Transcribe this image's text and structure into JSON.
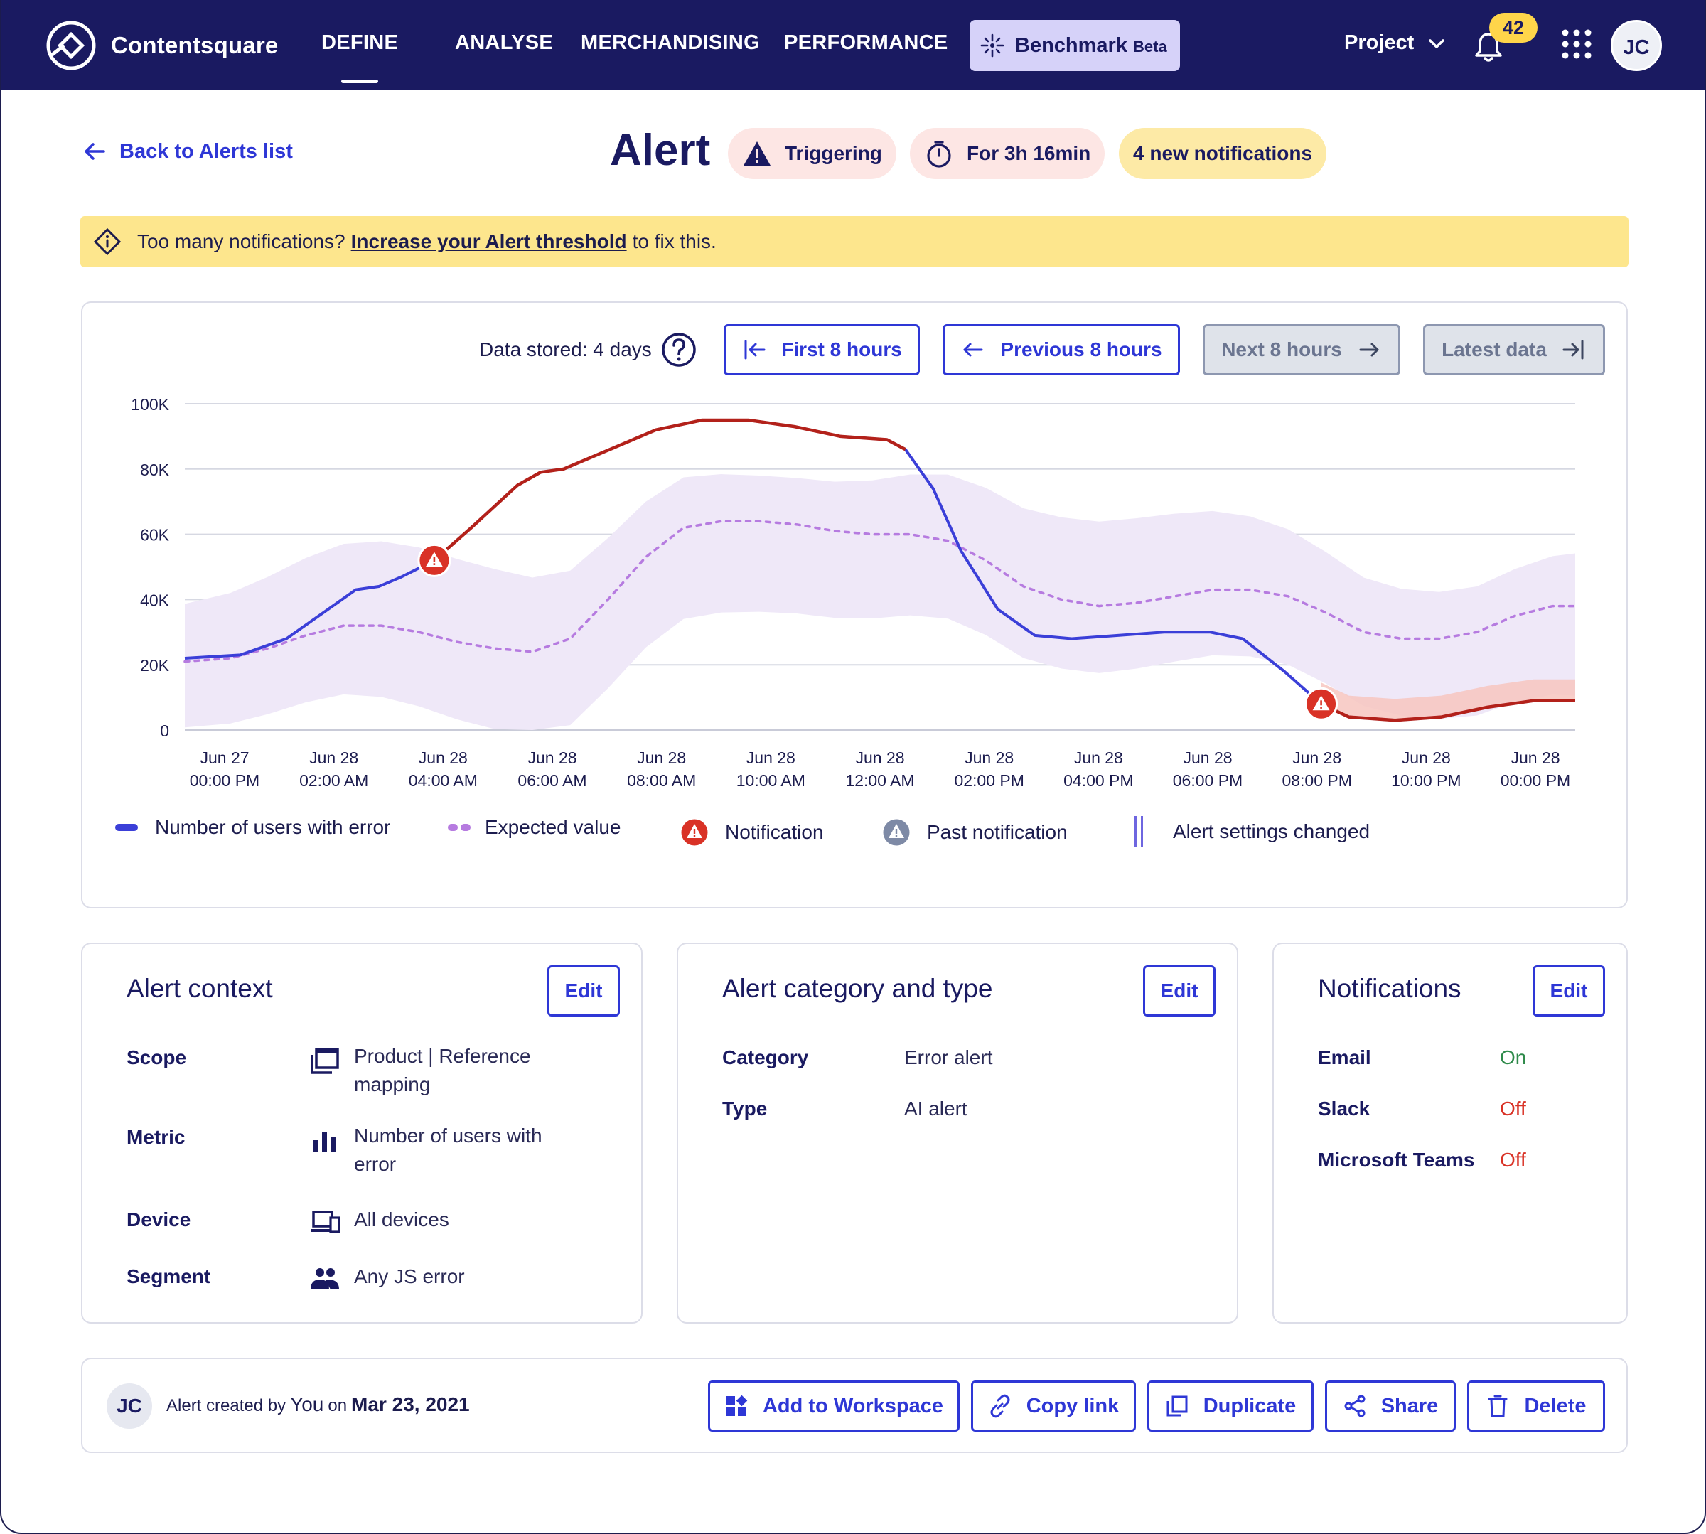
{
  "nav": {
    "brand": "Contentsquare",
    "links": [
      "DEFINE",
      "ANALYSE",
      "MERCHANDISING",
      "PERFORMANCE"
    ],
    "benchmark_label": "Benchmark",
    "benchmark_badge": "Beta",
    "project_label": "Project",
    "notification_count": "42",
    "user_initials": "JC"
  },
  "header": {
    "back_label": "Back to Alerts list",
    "title": "Alert",
    "status_pill": "Triggering",
    "duration_pill": "For 3h 16min",
    "notifications_pill": "4 new notifications"
  },
  "banner": {
    "prefix": "Too many notifications?",
    "link": "Increase your Alert threshold",
    "suffix": "to fix this."
  },
  "chart_controls": {
    "data_stored": "Data stored: 4 days",
    "first_label": "First 8 hours",
    "previous_label": "Previous 8 hours",
    "next_label": "Next 8 hours",
    "latest_label": "Latest data"
  },
  "chart_data": {
    "type": "line",
    "y_ticks": [
      "100K",
      "80K",
      "60K",
      "40K",
      "20K",
      "0"
    ],
    "ylim": [
      0,
      100000
    ],
    "x_ticks": [
      [
        "Jun 27",
        "00:00 PM"
      ],
      [
        "Jun 28",
        "02:00 AM"
      ],
      [
        "Jun 28",
        "04:00 AM"
      ],
      [
        "Jun 28",
        "06:00 AM"
      ],
      [
        "Jun 28",
        "08:00 AM"
      ],
      [
        "Jun 28",
        "10:00 AM"
      ],
      [
        "Jun 28",
        "12:00 AM"
      ],
      [
        "Jun 28",
        "02:00 PM"
      ],
      [
        "Jun 28",
        "04:00 PM"
      ],
      [
        "Jun 28",
        "06:00 PM"
      ],
      [
        "Jun 28",
        "08:00 PM"
      ],
      [
        "Jun 28",
        "10:00 PM"
      ],
      [
        "Jun 28",
        "00:00 PM"
      ]
    ],
    "x_range_hours": [
      -1.2,
      24.3
    ],
    "series": [
      {
        "name": "Number of users with error",
        "color": "#3b3fd8",
        "alert_color": "#b3211a",
        "points": [
          [
            -1.2,
            22000
          ],
          [
            0,
            23000
          ],
          [
            1,
            28000
          ],
          [
            2,
            38000
          ],
          [
            2.5,
            43000
          ],
          [
            3,
            44000
          ],
          [
            3.5,
            47000
          ],
          [
            4.2,
            52000
          ],
          [
            5,
            62000
          ],
          [
            6,
            75000
          ],
          [
            6.5,
            79000
          ],
          [
            7,
            80000
          ],
          [
            8,
            86000
          ],
          [
            9,
            92000
          ],
          [
            10,
            95000
          ],
          [
            11,
            95000
          ],
          [
            12,
            93000
          ],
          [
            13,
            90000
          ],
          [
            14,
            89000
          ],
          [
            14.4,
            86000
          ],
          [
            15,
            74000
          ],
          [
            15.6,
            55000
          ],
          [
            16.4,
            37000
          ],
          [
            17.2,
            29000
          ],
          [
            18,
            28000
          ],
          [
            19,
            29000
          ],
          [
            20,
            30000
          ],
          [
            21,
            30000
          ],
          [
            21.7,
            28000
          ],
          [
            22.6,
            18000
          ],
          [
            23.4,
            8000
          ],
          [
            24,
            4000
          ],
          [
            25,
            3000
          ],
          [
            26,
            4000
          ],
          [
            27,
            7000
          ],
          [
            28,
            9000
          ],
          [
            28.9,
            9000
          ]
        ]
      },
      {
        "name": "Expected value",
        "color": "#b67be0",
        "points": [
          [
            -1.2,
            21000
          ],
          [
            0,
            22000
          ],
          [
            1,
            25000
          ],
          [
            2,
            29000
          ],
          [
            3,
            32000
          ],
          [
            4,
            32000
          ],
          [
            5,
            30000
          ],
          [
            6,
            27000
          ],
          [
            7,
            25000
          ],
          [
            8,
            24000
          ],
          [
            9,
            28000
          ],
          [
            10,
            40000
          ],
          [
            11,
            53000
          ],
          [
            12,
            62000
          ],
          [
            13,
            64000
          ],
          [
            14,
            64000
          ],
          [
            15,
            63000
          ],
          [
            16,
            61000
          ],
          [
            17,
            60000
          ],
          [
            18,
            60000
          ],
          [
            19,
            58000
          ],
          [
            20,
            52000
          ],
          [
            21,
            44000
          ],
          [
            22,
            40000
          ],
          [
            23,
            38000
          ],
          [
            24,
            39000
          ],
          [
            25,
            41000
          ],
          [
            26,
            43000
          ],
          [
            27,
            43000
          ],
          [
            28,
            41000
          ],
          [
            29,
            36000
          ],
          [
            30,
            30000
          ],
          [
            31,
            28000
          ],
          [
            32,
            28000
          ],
          [
            33,
            30000
          ],
          [
            34,
            35000
          ],
          [
            35,
            38000
          ],
          [
            35.6,
            38000
          ]
        ]
      }
    ],
    "legend": [
      "Number of users with error",
      "Expected value",
      "Notification",
      "Past notification",
      "Alert settings changed"
    ]
  },
  "cards": {
    "context": {
      "title": "Alert context",
      "edit": "Edit",
      "rows": [
        {
          "label": "Scope",
          "value": "Product | Reference mapping",
          "icon": "pages-icon"
        },
        {
          "label": "Metric",
          "value": "Number of users with error",
          "icon": "bar-chart-icon"
        },
        {
          "label": "Device",
          "value": "All devices",
          "icon": "devices-icon"
        },
        {
          "label": "Segment",
          "value": "Any JS error",
          "icon": "users-icon"
        }
      ]
    },
    "category": {
      "title": "Alert category and type",
      "edit": "Edit",
      "rows": [
        {
          "label": "Category",
          "value": "Error alert"
        },
        {
          "label": "Type",
          "value": "AI alert"
        }
      ]
    },
    "notifications": {
      "title": "Notifications",
      "edit": "Edit",
      "rows": [
        {
          "label": "Email",
          "value": "On"
        },
        {
          "label": "Slack",
          "value": "Off"
        },
        {
          "label": "Microsoft Teams",
          "value": "Off"
        }
      ],
      "on_color": "#2e8a4a",
      "off_color": "#d93226"
    }
  },
  "footer": {
    "initials": "JC",
    "created_prefix": "Alert created by",
    "created_by": "You",
    "created_on": "on",
    "created_date": "Mar 23, 2021",
    "actions": [
      "Add to Workspace",
      "Copy link",
      "Duplicate",
      "Share",
      "Delete"
    ]
  },
  "colors": {
    "nav_bg": "#1a1a61",
    "accent": "#2e37d6",
    "band": "#efe8f8",
    "alert_red": "#d93226",
    "banner_bg": "#fde68d"
  }
}
